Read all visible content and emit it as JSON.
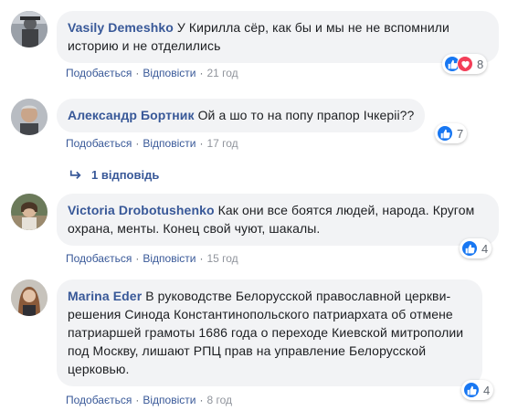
{
  "comments": [
    {
      "author": "Vasily Demeshko",
      "text": "У Кирилла сёр, как бы и мы не не вспомнили историю и не отделились",
      "like_label": "Подобається",
      "reply_label": "Відповісти",
      "time": "21 год",
      "reaction_count": "8",
      "reactions": [
        "like-icon",
        "love-icon"
      ]
    },
    {
      "author": "Александр Бортник",
      "text": "Ой а шо то на попу прапор Ічкеріі??",
      "like_label": "Подобається",
      "reply_label": "Відповісти",
      "time": "17 год",
      "reaction_count": "7",
      "reactions": [
        "like-icon"
      ],
      "replies_label": "1 відповідь"
    },
    {
      "author": "Victoria Drobotushenko",
      "text": "Как они все боятся людей, народа. Кругом охрана, менты. Конец свой чуют, шакалы.",
      "like_label": "Подобається",
      "reply_label": "Відповісти",
      "time": "15 год",
      "reaction_count": "4",
      "reactions": [
        "like-icon"
      ]
    },
    {
      "author": "Marina Eder",
      "text": "В руководстве Белорусской православной церкви- решения Синода Константинопольского патриархата об отмене патриаршей грамоты 1686 года о переходе Киевской митрополии под Москву, лишают РПЦ прав на управление Белорусской церковью.",
      "like_label": "Подобається",
      "reply_label": "Відповісти",
      "time": "8 год",
      "reaction_count": "4",
      "reactions": [
        "like-icon"
      ]
    }
  ],
  "colors": {
    "author": "#385898",
    "bubble": "#f2f3f5",
    "like": "#1877f2",
    "love": "#f33e58",
    "meta": "#90949c"
  }
}
